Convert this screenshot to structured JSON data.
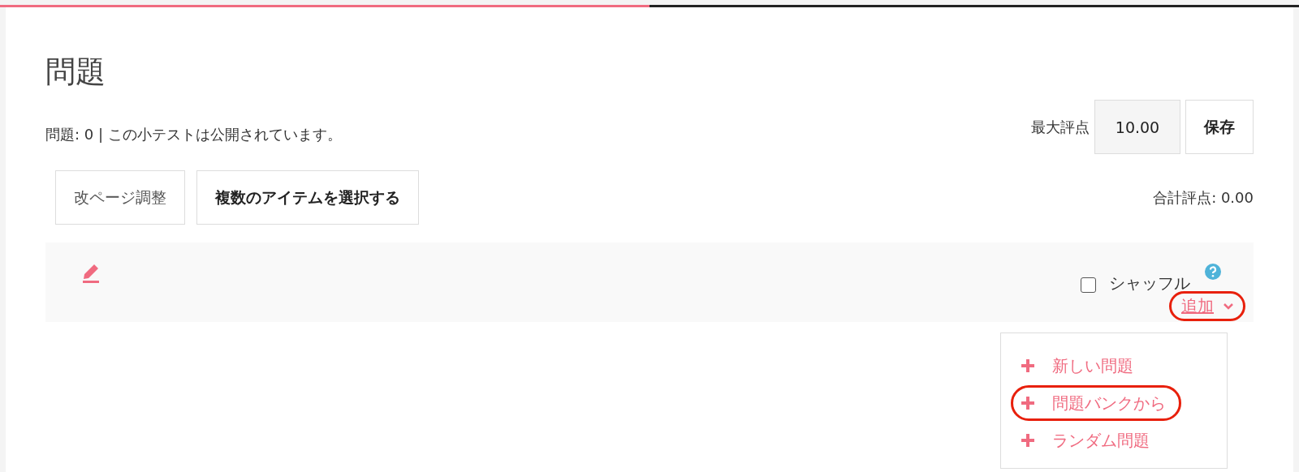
{
  "progress": {
    "level": 0.5
  },
  "heading": "問題",
  "info": "問題: 0 | この小テストは公開されています。",
  "max_grade": {
    "label": "最大評点",
    "value": "10.00",
    "save": "保存"
  },
  "buttons": [
    "改ページ調整",
    "複数のアイテムを選択する"
  ],
  "total_grade": "合計評点: 0.00",
  "section": {
    "shuffle": {
      "label": "シャッフル",
      "checked": false
    },
    "add": {
      "label": "追加",
      "highlighted": true
    }
  },
  "menu": [
    {
      "label": "新しい問題",
      "highlighted": false
    },
    {
      "label": "問題バンクから",
      "highlighted": true
    },
    {
      "label": "ランダム問題",
      "highlighted": false
    }
  ]
}
